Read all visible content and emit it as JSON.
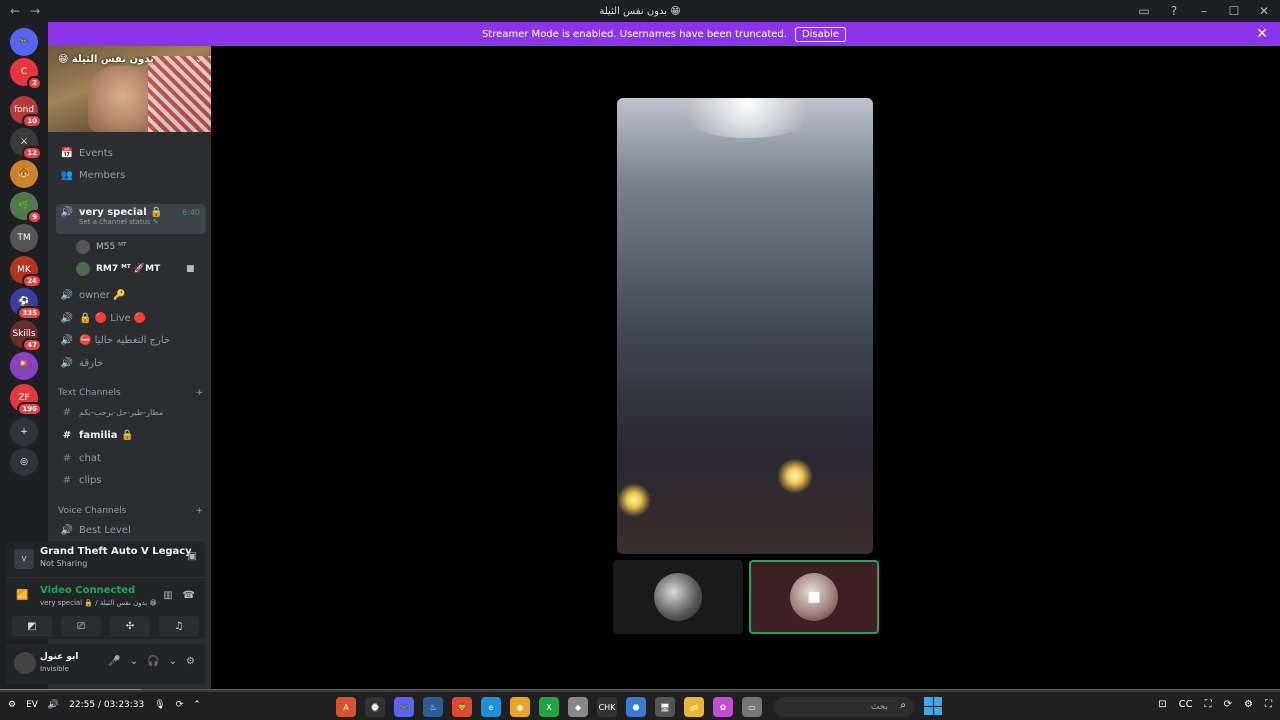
{
  "titlebar": {
    "title": "بدون نفس الثيلة 😁",
    "back": "←",
    "forward": "→",
    "icons": [
      "inbox-icon",
      "help-icon"
    ],
    "min": "–",
    "max": "☐",
    "close": "✕"
  },
  "banner": {
    "text": "Streamer Mode is enabled. Usernames have been truncated.",
    "disable_label": "Disable",
    "close": "✕"
  },
  "servers": [
    {
      "label": "🎮",
      "badge": ""
    },
    {
      "label": "C",
      "badge": "2"
    },
    {
      "label": "fond",
      "badge": "10"
    },
    {
      "label": "⚔",
      "badge": "12"
    },
    {
      "label": "🐯",
      "badge": ""
    },
    {
      "label": "🌿",
      "badge": "9"
    },
    {
      "label": "TM",
      "badge": ""
    },
    {
      "label": "MK",
      "badge": "24"
    },
    {
      "label": "⚽",
      "badge": "335"
    },
    {
      "label": "Skills",
      "badge": "47"
    },
    {
      "label": "🎴",
      "badge": ""
    },
    {
      "label": "ZF",
      "badge": "196"
    },
    {
      "label": "+",
      "badge": ""
    },
    {
      "label": "◎",
      "badge": ""
    }
  ],
  "channels": {
    "server_name": "بدون نفس الثيلة 😁",
    "top_items": [
      {
        "icon": "📅",
        "label": "Events"
      },
      {
        "icon": "👥",
        "label": "Members"
      }
    ],
    "active_voice": {
      "label": "very special 🔒",
      "time": "6:40",
      "status": "Set a channel status ✎"
    },
    "voice_users": [
      {
        "name": "M55 ᴹᵀ"
      },
      {
        "name": "RM7 ᴹᵀ 🚀MT"
      }
    ],
    "voice_channels": [
      {
        "label": "owner 🔑"
      },
      {
        "label": "🔒 🔴 Live 🔴"
      },
      {
        "label": "⛔ خارج التغطيه حاليا"
      },
      {
        "label": "خارقة"
      }
    ],
    "text_category": "Text Channels",
    "text_channels": [
      {
        "label": "مطار-طير-حل-يرحب-بكم",
        "bold": false
      },
      {
        "label": "familia 🔒",
        "bold": true
      },
      {
        "label": "chat",
        "bold": false
      },
      {
        "label": "clips",
        "bold": false
      }
    ],
    "voice_category": "Voice Channels",
    "voice_bottom": "Best Level"
  },
  "game": {
    "title": "Grand Theft Auto V Legacy",
    "subtitle": "Not Sharing",
    "icon_label": "V"
  },
  "voice": {
    "status": "Video Connected",
    "channel": "very special 🔒 / بدون نفس الثيلة 😁"
  },
  "user": {
    "name": "ابو عنول",
    "status": "Invisible"
  },
  "playback": {
    "progress": 0.11,
    "time": "22:55 / 03:23:33"
  },
  "taskbar": {
    "apps": [
      "A",
      "⌚",
      "🎮",
      "♨",
      "🦁",
      "e",
      "◉",
      "X",
      "◆",
      "CHK",
      "⬣",
      "🖥",
      "📁",
      "✿",
      "▭"
    ],
    "search_text": "بحث",
    "left_text": "EV",
    "right_icons": [
      "⊡",
      "CC",
      "⛶",
      "⟳",
      "⚙",
      "⛶"
    ]
  }
}
